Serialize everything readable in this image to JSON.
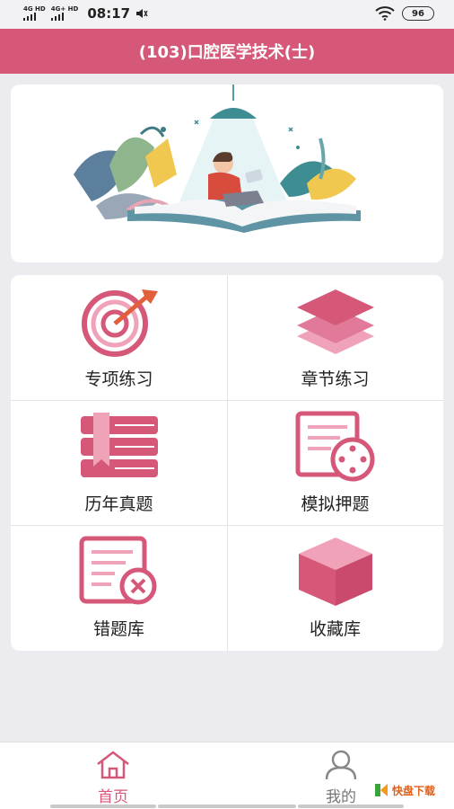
{
  "status": {
    "net1": "4G HD",
    "net2": "4G+ HD",
    "time": "08:17",
    "battery": "96"
  },
  "header": {
    "title": "(103)口腔医学技术(士)"
  },
  "menu": [
    {
      "label": "专项练习",
      "icon": "target-icon"
    },
    {
      "label": "章节练习",
      "icon": "layers-icon"
    },
    {
      "label": "历年真题",
      "icon": "books-icon"
    },
    {
      "label": "模拟押题",
      "icon": "mock-exam-icon"
    },
    {
      "label": "错题库",
      "icon": "wrong-questions-icon"
    },
    {
      "label": "收藏库",
      "icon": "favorites-box-icon"
    }
  ],
  "nav": {
    "home": "首页",
    "mine": "我的"
  },
  "watermark": {
    "text": "快盘下载"
  },
  "colors": {
    "accent": "#d55879",
    "light": "#f0a3b8",
    "background": "#ececf0"
  }
}
